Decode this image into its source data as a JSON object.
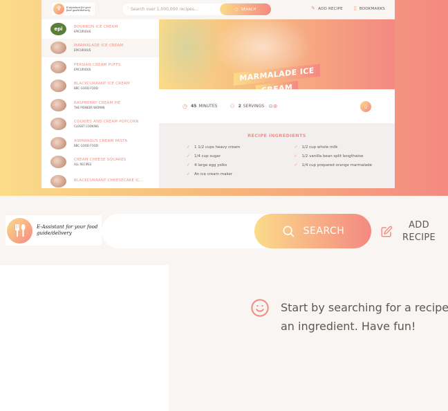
{
  "preview": {
    "logo_text": "E-Assistant for your food guide/delivery",
    "search_placeholder": "Search over 1,000,000 recipes...",
    "search_button": "SEARCH",
    "nav": {
      "add_recipe": "ADD RECIPE",
      "bookmarks": "BOOKMARKS"
    },
    "results": [
      {
        "name": "BOURBON ICE CREAM",
        "publisher": "EPICURIOUS",
        "thumb": "epi"
      },
      {
        "name": "MARMALADE ICE CREAM",
        "publisher": "EPICURIOUS",
        "thumb": "food"
      },
      {
        "name": "PERSIAN CREAM PUFFS",
        "publisher": "EPICURIOUS",
        "thumb": "food"
      },
      {
        "name": "BLACKCURRANT ICE CREAM",
        "publisher": "BBC GOOD FOOD",
        "thumb": "food"
      },
      {
        "name": "RASPBERRY CREAM PIE",
        "publisher": "THE PIONEER WOMAN",
        "thumb": "food"
      },
      {
        "name": "COOKIES AND CREAM POPCORN",
        "publisher": "CLOSET COOKING",
        "thumb": "food"
      },
      {
        "name": "ASPARAGUS CREAM PASTA",
        "publisher": "BBC GOOD FOOD",
        "thumb": "food"
      },
      {
        "name": "CREAM CHEESE SQUARES",
        "publisher": "ALL RECIPES",
        "thumb": "food"
      },
      {
        "name": "BLACKCURRANT CHEESECAKE IC...",
        "publisher": "",
        "thumb": "food"
      }
    ],
    "epi_logo": "epi",
    "recipe": {
      "title_line1": "MARMALADE ICE",
      "title_line2": "CREAM",
      "minutes_value": "45",
      "minutes_label": "MINUTES",
      "servings_value": "2",
      "servings_label": "SERVINGS",
      "ingredients_heading": "RECIPE INGREDIENTS",
      "ingredients": [
        "1 1/2 cups heavy cream",
        "1/2 cup whole milk",
        "1/4 cup sugar",
        "1/2 vanilla bean split lengthwise",
        "4 large egg yolks",
        "1/4 cup prepared orange marmalade",
        "An ice cream maker"
      ]
    }
  },
  "header": {
    "logo_text": "E-Assistant for your food guide/delivery",
    "search_value": "",
    "search_button": "SEARCH",
    "add_recipe": "ADD RECIPE"
  },
  "message": {
    "text": "Start by searching for a recipe an ingredient. Have fun!"
  },
  "colors": {
    "gradient_start": "#fbdb89",
    "gradient_end": "#f48982",
    "accent": "#f38e82",
    "text": "#615551",
    "background": "#f9f5f3"
  },
  "icons": {
    "logo": "fork-spoon-icon",
    "search": "search-icon",
    "add_recipe": "edit-icon",
    "bookmarks": "bookmark-icon",
    "message": "smile-icon",
    "clock": "clock-icon",
    "users": "users-icon",
    "check": "check-icon"
  }
}
